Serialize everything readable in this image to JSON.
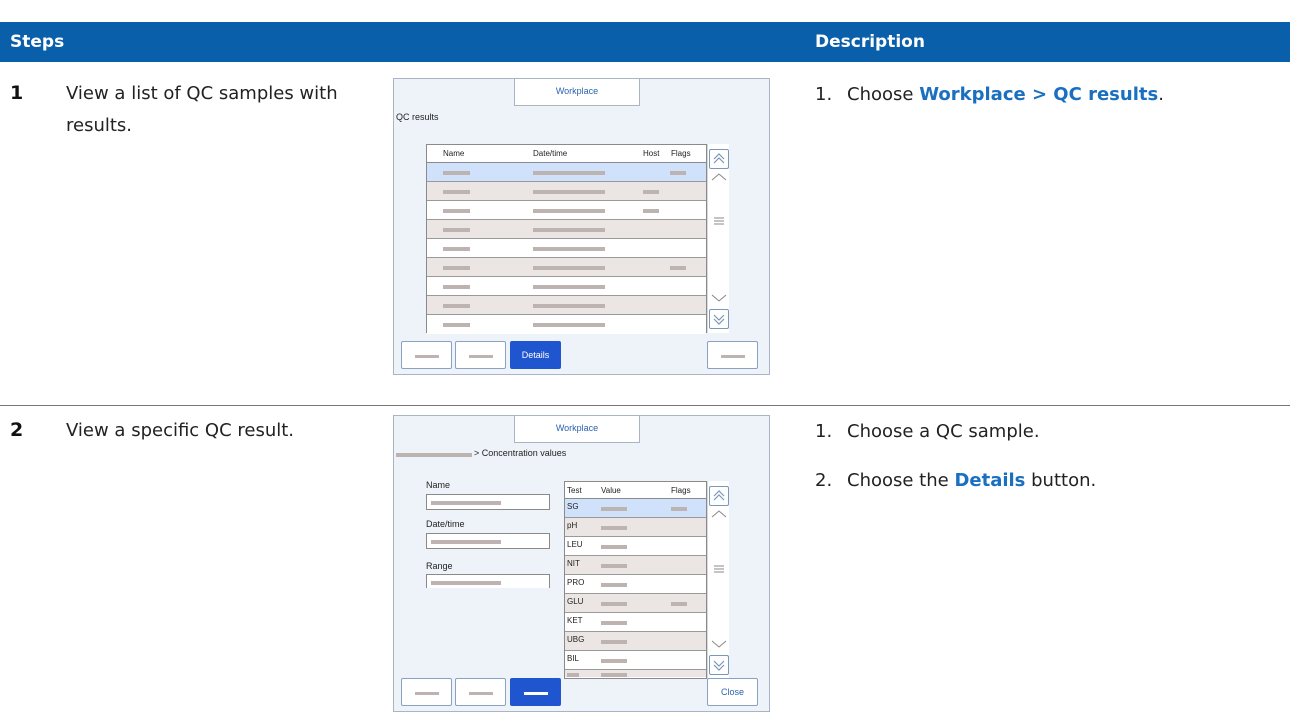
{
  "header": {
    "steps": "Steps",
    "description": "Description"
  },
  "rows": [
    {
      "num": "1",
      "step": "View a list of QC samples with results.",
      "desc": [
        {
          "n": "1.",
          "pre": "Choose ",
          "bold": "Workplace > QC results",
          "post": "."
        }
      ]
    },
    {
      "num": "2",
      "step": "View a specific QC result.",
      "desc": [
        {
          "n": "1.",
          "pre": "Choose a QC sample.",
          "bold": "",
          "post": ""
        },
        {
          "n": "2.",
          "pre": "Choose the ",
          "bold": "Details",
          "post": " button."
        }
      ]
    }
  ],
  "screen1": {
    "tab": "Workplace",
    "title": "QC results",
    "columns": [
      "Name",
      "Date/time",
      "Host",
      "Flags"
    ],
    "button_details": "Details"
  },
  "screen2": {
    "tab": "Workplace",
    "breadcrumb": "> Concentration values",
    "label_name": "Name",
    "label_datetime": "Date/time",
    "label_range": "Range",
    "columns": [
      "Test",
      "Value",
      "Flags"
    ],
    "tests": [
      "SG",
      "pH",
      "LEU",
      "NIT",
      "PRO",
      "GLU",
      "KET",
      "UBG",
      "BIL"
    ],
    "button_close": "Close"
  },
  "colors": {
    "header_bg": "#0a5fab",
    "accent_text": "#1a6fc0",
    "primary_button": "#1f56cf",
    "selected_row": "#d0e2fb"
  }
}
